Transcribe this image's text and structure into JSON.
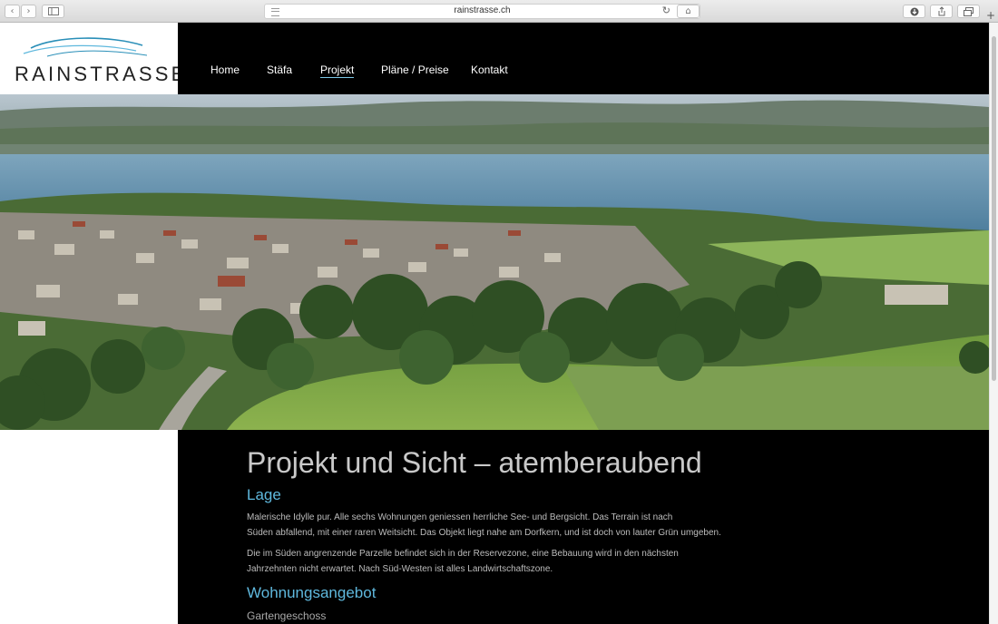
{
  "browser": {
    "url": "rainstrasse.ch",
    "back_icon": "chevron-left-icon",
    "forward_icon": "chevron-right-icon"
  },
  "logo": {
    "text": "RAINSTRASSE"
  },
  "nav": {
    "items": [
      {
        "label": "Home",
        "active": false
      },
      {
        "label": "Stäfa",
        "active": false
      },
      {
        "label": "Projekt",
        "active": true
      },
      {
        "label": "Pläne / Preise",
        "active": false
      },
      {
        "label": "Kontakt",
        "active": false
      }
    ]
  },
  "content": {
    "title": "Projekt und Sicht – atemberaubend",
    "section1_title": "Lage",
    "p1_line1": "Malerische Idylle pur. Alle sechs Wohnungen geniessen herrliche See- und Bergsicht. Das Terrain ist nach",
    "p1_line2": "Süden abfallend, mit einer raren Weitsicht. Das Objekt liegt nahe am Dorfkern, und ist doch von lauter Grün umgeben.",
    "p2_line1": "Die im Süden angrenzende Parzelle befindet sich in der Reservezone, eine Bebauung wird in den nächsten",
    "p2_line2": "Jahrzehnten nicht erwartet. Nach Süd-Westen ist alles Landwirtschaftszone.",
    "section2_title": "Wohnungsangebot",
    "subsection_title": "Gartengeschoss"
  },
  "colors": {
    "accent": "#5fb8dd",
    "nav_bg": "#000000"
  }
}
